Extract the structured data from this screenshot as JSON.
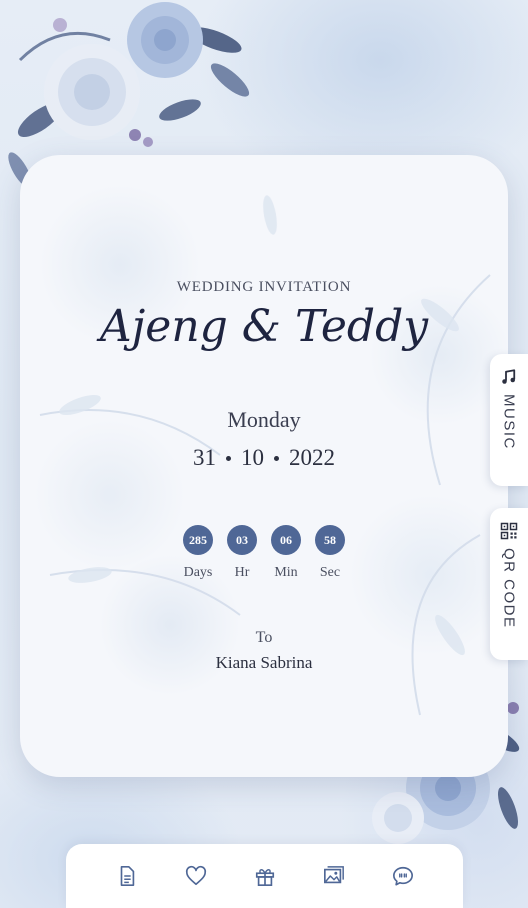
{
  "invitation": {
    "label": "WEDDING INVITATION",
    "couple": "Ajeng & Teddy",
    "day": "Monday",
    "date": {
      "day": "31",
      "month": "10",
      "year": "2022"
    }
  },
  "countdown": [
    {
      "value": "285",
      "label": "Days"
    },
    {
      "value": "03",
      "label": "Hr"
    },
    {
      "value": "06",
      "label": "Min"
    },
    {
      "value": "58",
      "label": "Sec"
    }
  ],
  "guest": {
    "to_label": "To",
    "name": "Kiana Sabrina"
  },
  "side_tabs": {
    "music": {
      "label": "MUSIC",
      "icon": "music-note-icon"
    },
    "qr": {
      "label": "QR CODE",
      "icon": "qr-code-icon"
    }
  },
  "bottom_nav": [
    {
      "icon": "document-icon"
    },
    {
      "icon": "heart-icon"
    },
    {
      "icon": "gift-icon"
    },
    {
      "icon": "gallery-icon"
    },
    {
      "icon": "chat-icon"
    }
  ],
  "colors": {
    "accent": "#4f6796",
    "text_dark": "#1e2440",
    "card_bg": "#f5f7fb",
    "background": "#dfe8f3"
  }
}
